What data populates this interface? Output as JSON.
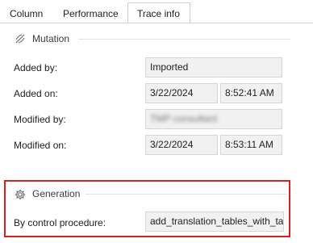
{
  "tabs": [
    {
      "label": "Column"
    },
    {
      "label": "Performance"
    },
    {
      "label": "Trace info",
      "active": true
    }
  ],
  "mutation": {
    "title": "Mutation",
    "icon": "mutation-icon",
    "added_by_label": "Added by:",
    "added_by_value": "Imported",
    "added_on_label": "Added on:",
    "added_on_date": "3/22/2024",
    "added_on_time": "8:52:41 AM",
    "modified_by_label": "Modified by:",
    "modified_by_value": "TMP consultant",
    "modified_on_label": "Modified on:",
    "modified_on_date": "3/22/2024",
    "modified_on_time": "8:53:11 AM"
  },
  "generation": {
    "title": "Generation",
    "icon": "gear-icon",
    "procedure_label": "By control procedure:",
    "procedure_value": "add_translation_tables_with_tag"
  },
  "colors": {
    "highlight": "#d71f1f",
    "field_bg": "#f1f1f1",
    "field_border": "#d6d6d6"
  }
}
